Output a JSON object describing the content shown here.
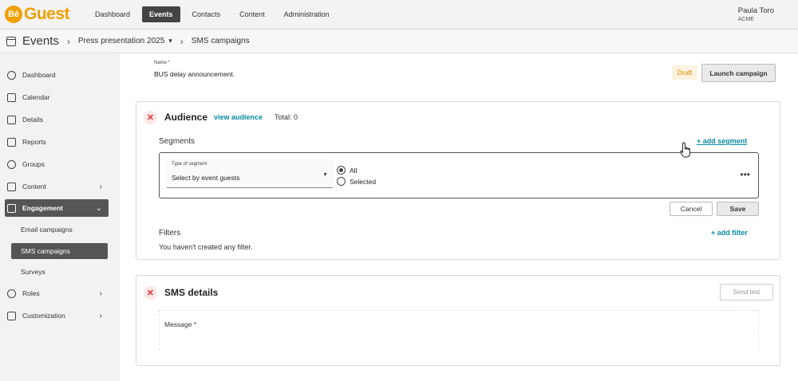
{
  "logo": {
    "be": "Bé",
    "text": "Guest"
  },
  "nav": [
    {
      "label": "Dashboard",
      "active": false
    },
    {
      "label": "Events",
      "active": true
    },
    {
      "label": "Contacts",
      "active": false
    },
    {
      "label": "Content",
      "active": false
    },
    {
      "label": "Administration",
      "active": false
    }
  ],
  "user": {
    "name": "Paula Toro",
    "org": "ACME"
  },
  "breadcrumb": {
    "root": "Events",
    "event": "Press presentation 2025",
    "current": "SMS campaigns"
  },
  "sidebar": {
    "items": [
      {
        "label": "Dashboard",
        "icon": "dashboard-icon"
      },
      {
        "label": "Calendar",
        "icon": "calendar-icon"
      },
      {
        "label": "Details",
        "icon": "details-icon"
      },
      {
        "label": "Reports",
        "icon": "reports-icon"
      },
      {
        "label": "Groups",
        "icon": "groups-icon"
      },
      {
        "label": "Content",
        "icon": "content-icon"
      },
      {
        "label": "Engagement",
        "icon": "engagement-icon"
      },
      {
        "label": "Roles",
        "icon": "roles-icon"
      },
      {
        "label": "Customization",
        "icon": "customization-icon"
      }
    ],
    "engagement_sub": [
      {
        "label": "Email campaigns"
      },
      {
        "label": "SMS campaigns"
      },
      {
        "label": "Surveys"
      }
    ]
  },
  "campaign": {
    "name_label": "Name *",
    "name_value": "BUS delay announcement.",
    "status": "Draft",
    "launch_label": "Launch campaign"
  },
  "audience": {
    "title": "Audience",
    "view_link": "view audience",
    "total": "Total: 0",
    "segments_label": "Segments",
    "add_segment": "+ add segment",
    "segment": {
      "type_label": "Type of segment",
      "type_value": "Select by event guests",
      "option_all": "All",
      "option_selected": "Selected",
      "more": "•••"
    },
    "cancel_label": "Cancel",
    "save_label": "Save",
    "filters_label": "Filters",
    "add_filter": "+ add filter",
    "no_filters": "You haven't created any filter."
  },
  "sms": {
    "title": "SMS details",
    "send_test": "Send test",
    "message_label": "Message *"
  },
  "colors": {
    "brand": "#f0a000",
    "link": "#0a8aa0",
    "draft_text": "#d88a00",
    "close_red": "#d33333"
  }
}
